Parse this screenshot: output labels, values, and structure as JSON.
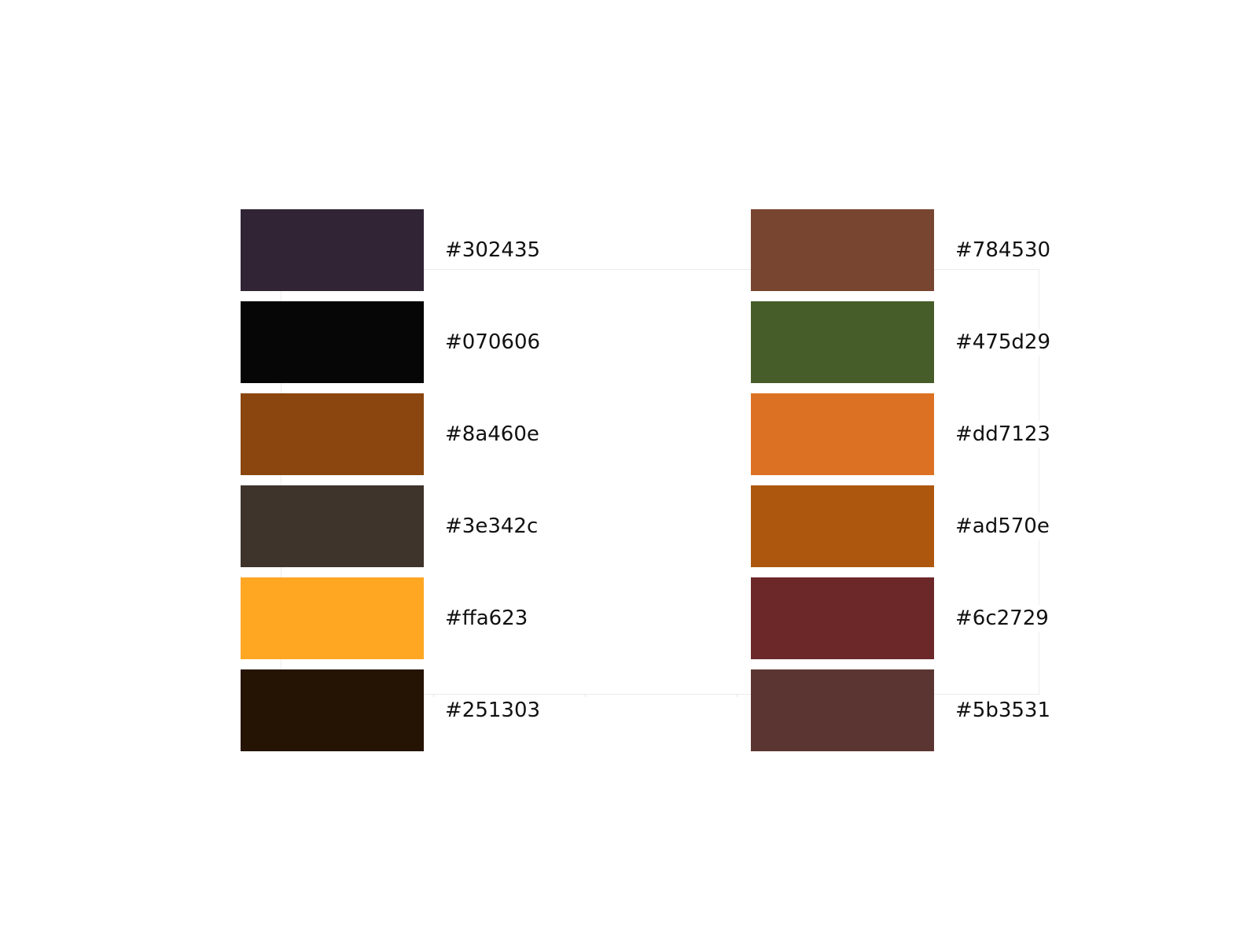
{
  "palette": {
    "left": [
      {
        "hex": "#302435",
        "color": "#302435"
      },
      {
        "hex": "#070606",
        "color": "#070606"
      },
      {
        "hex": "#8a460e",
        "color": "#8a460e"
      },
      {
        "hex": "#3e342c",
        "color": "#3e342c"
      },
      {
        "hex": "#ffa623",
        "color": "#ffa623"
      },
      {
        "hex": "#251303",
        "color": "#251303"
      }
    ],
    "right": [
      {
        "hex": "#784530",
        "color": "#784530"
      },
      {
        "hex": "#475d29",
        "color": "#475d29"
      },
      {
        "hex": "#dd7123",
        "color": "#dd7123"
      },
      {
        "hex": "#ad570e",
        "color": "#ad570e"
      },
      {
        "hex": "#6c2729",
        "color": "#6c2729"
      },
      {
        "hex": "#5b3531",
        "color": "#5b3531"
      }
    ]
  }
}
